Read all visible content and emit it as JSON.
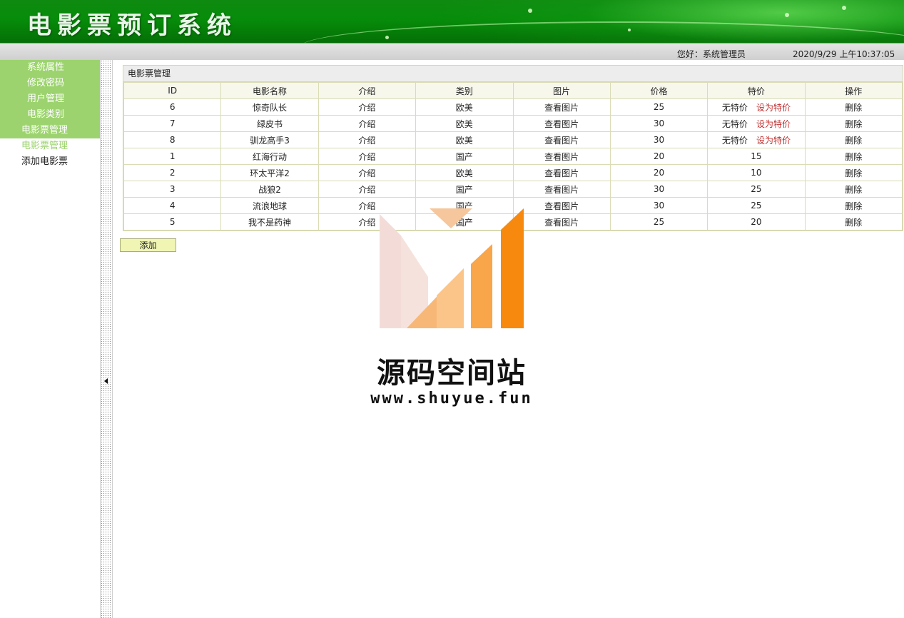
{
  "header": {
    "title": "电影票预订系统",
    "greeting": "您好：系统管理员",
    "datetime": "2020/9/29 上午10:37:05"
  },
  "sidebar": {
    "items": [
      {
        "label": "系统属性"
      },
      {
        "label": "修改密码"
      },
      {
        "label": "用户管理"
      },
      {
        "label": "电影类别"
      }
    ],
    "group_label": "电影票管理",
    "subitems": [
      {
        "label": "电影票管理",
        "active": true
      },
      {
        "label": "添加电影票",
        "active": false
      }
    ]
  },
  "panel": {
    "title": "电影票管理",
    "columns": [
      "ID",
      "电影名称",
      "介绍",
      "类别",
      "图片",
      "价格",
      "特价",
      "操作"
    ],
    "rows": [
      {
        "id": "6",
        "name": "惊奇队长",
        "intro": "介绍",
        "category": "欧美",
        "image": "查看图片",
        "price": "25",
        "special": "无特价",
        "special_action": "设为特价",
        "op": "删除"
      },
      {
        "id": "7",
        "name": "绿皮书",
        "intro": "介绍",
        "category": "欧美",
        "image": "查看图片",
        "price": "30",
        "special": "无特价",
        "special_action": "设为特价",
        "op": "删除"
      },
      {
        "id": "8",
        "name": "驯龙高手3",
        "intro": "介绍",
        "category": "欧美",
        "image": "查看图片",
        "price": "30",
        "special": "无特价",
        "special_action": "设为特价",
        "op": "删除"
      },
      {
        "id": "1",
        "name": "红海行动",
        "intro": "介绍",
        "category": "国产",
        "image": "查看图片",
        "price": "20",
        "special": "15",
        "special_action": "",
        "op": "删除"
      },
      {
        "id": "2",
        "name": "环太平洋2",
        "intro": "介绍",
        "category": "欧美",
        "image": "查看图片",
        "price": "20",
        "special": "10",
        "special_action": "",
        "op": "删除"
      },
      {
        "id": "3",
        "name": "战狼2",
        "intro": "介绍",
        "category": "国产",
        "image": "查看图片",
        "price": "30",
        "special": "25",
        "special_action": "",
        "op": "删除"
      },
      {
        "id": "4",
        "name": "流浪地球",
        "intro": "介绍",
        "category": "国产",
        "image": "查看图片",
        "price": "30",
        "special": "25",
        "special_action": "",
        "op": "删除"
      },
      {
        "id": "5",
        "name": "我不是药神",
        "intro": "介绍",
        "category": "国产",
        "image": "查看图片",
        "price": "25",
        "special": "20",
        "special_action": "",
        "op": "删除"
      }
    ],
    "add_label": "添加"
  },
  "watermark": {
    "name": "源码空间站",
    "url": "www.shuyue.fun"
  },
  "colors": {
    "banner_green": "#078c0a",
    "menu_green": "#9cd36e",
    "special_red": "#c03030",
    "add_button_bg": "#f1f5b4"
  }
}
